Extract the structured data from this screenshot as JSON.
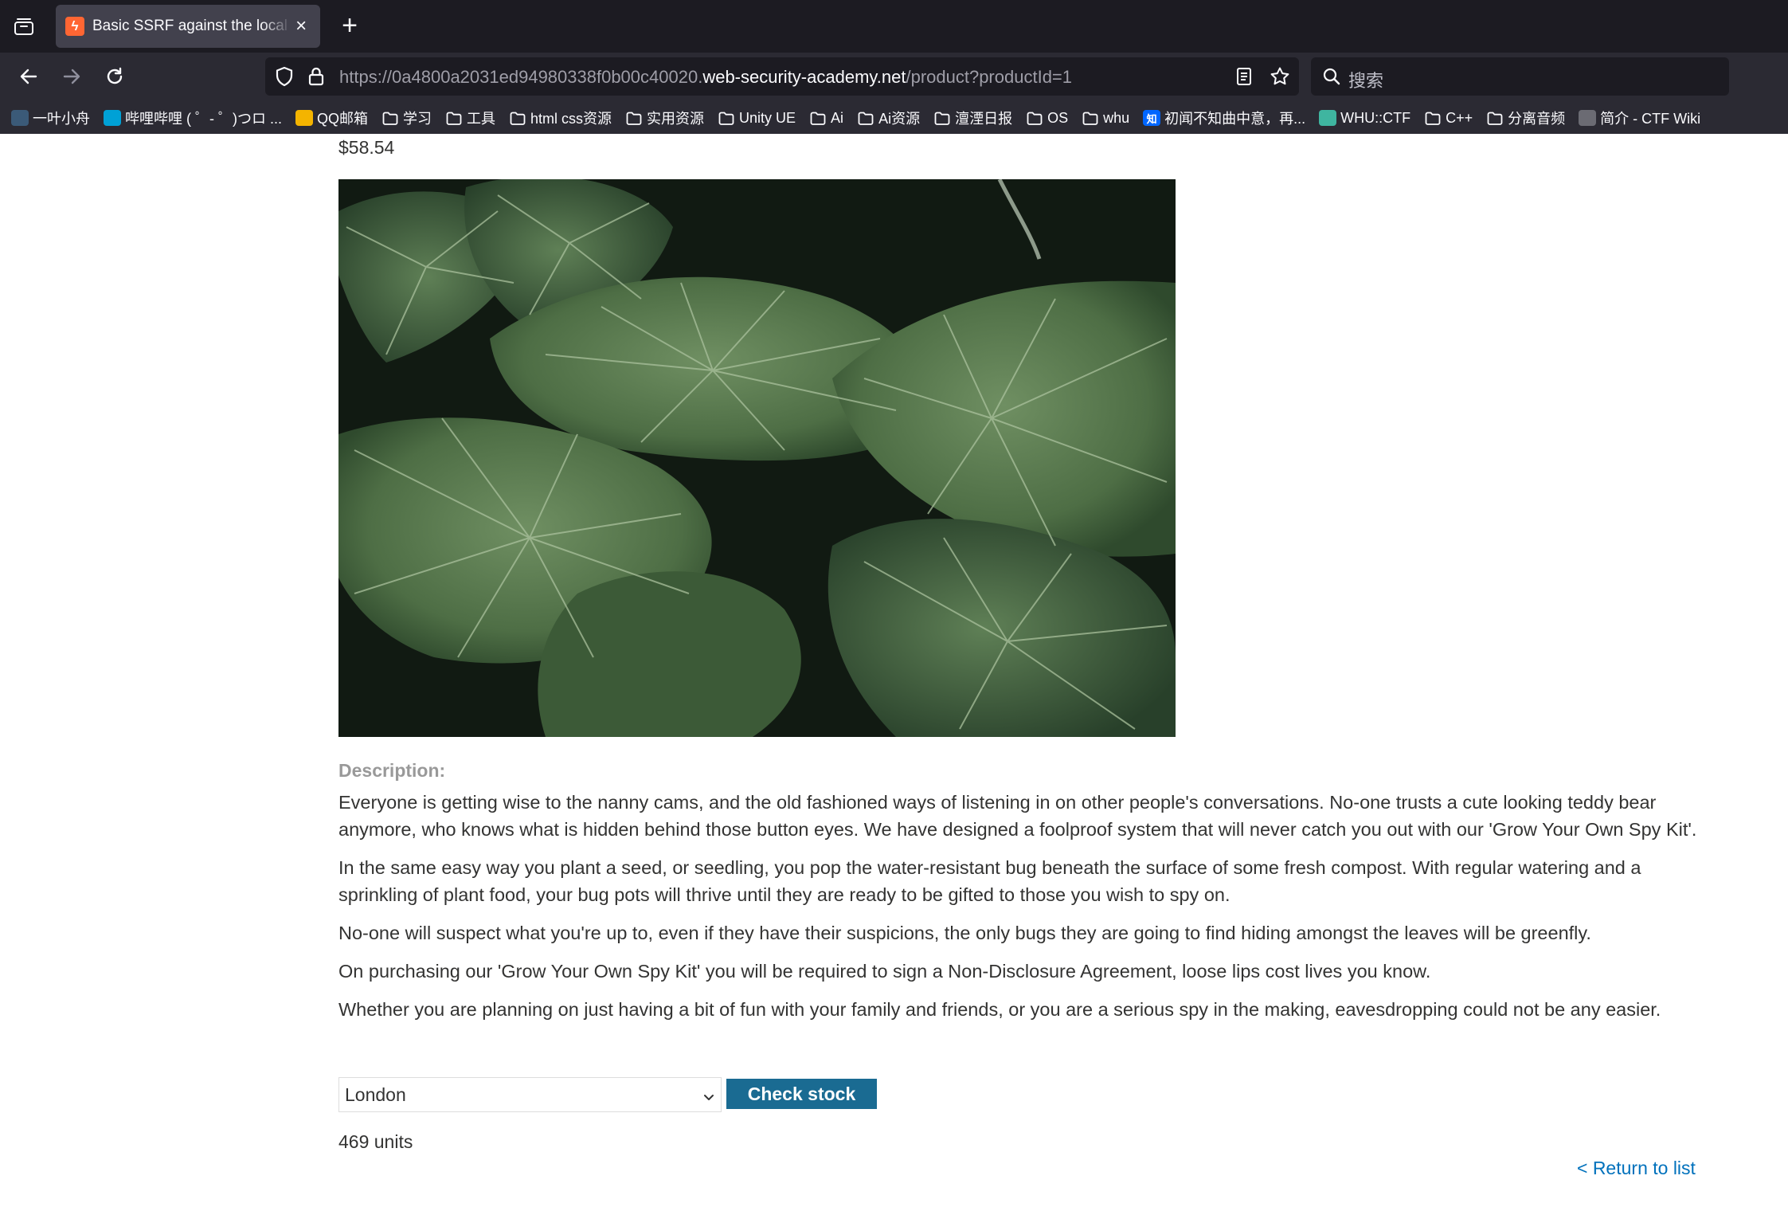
{
  "browser": {
    "tab": {
      "title": "Basic SSRF against the local s",
      "favicon": "lightning-bolt"
    },
    "url": {
      "prefix": "https://0a4800a2031ed94980338f0b00c40020.",
      "host": "web-security-academy.net",
      "path": "/product?productId=1"
    },
    "search": {
      "placeholder": "搜索"
    },
    "bookmarks": [
      {
        "label": "一叶小舟",
        "icon": "image-favicon"
      },
      {
        "label": "哔哩哔哩 ( ゜- ゜)つロ ...",
        "icon": "bilibili-favicon"
      },
      {
        "label": "QQ邮箱",
        "icon": "chrome-favicon"
      },
      {
        "label": "学习",
        "icon": "folder-icon"
      },
      {
        "label": "工具",
        "icon": "folder-icon"
      },
      {
        "label": "html css资源",
        "icon": "folder-icon"
      },
      {
        "label": "实用资源",
        "icon": "folder-icon"
      },
      {
        "label": "Unity UE",
        "icon": "folder-icon"
      },
      {
        "label": "Ai",
        "icon": "folder-icon"
      },
      {
        "label": "Ai资源",
        "icon": "folder-icon"
      },
      {
        "label": "澶湮日报",
        "icon": "folder-icon"
      },
      {
        "label": "OS",
        "icon": "folder-icon"
      },
      {
        "label": "whu",
        "icon": "folder-icon"
      },
      {
        "label": "初闻不知曲中意，再...",
        "icon": "zhihu-favicon"
      },
      {
        "label": "WHU::CTF",
        "icon": "ctf-favicon"
      },
      {
        "label": "C++",
        "icon": "folder-icon"
      },
      {
        "label": "分离音频",
        "icon": "folder-icon"
      },
      {
        "label": "简介 - CTF Wiki",
        "icon": "ctfwiki-favicon"
      }
    ]
  },
  "product": {
    "price": "$58.54",
    "description_label": "Description:",
    "paragraphs": [
      "Everyone is getting wise to the nanny cams, and the old fashioned ways of listening in on other people's conversations. No-one trusts a cute looking teddy bear anymore, who knows what is hidden behind those button eyes. We have designed a foolproof system that will never catch you out with our 'Grow Your Own Spy Kit'.",
      "In the same easy way you plant a seed, or seedling, you pop the water-resistant bug beneath the surface of some fresh compost. With regular watering and a sprinkling of plant food, your bug pots will thrive until they are ready to be gifted to those you wish to spy on.",
      "No-one will suspect what you're up to, even if they have their suspicions, the only bugs they are going to find hiding amongst the leaves will be greenfly.",
      "On purchasing our 'Grow Your Own Spy Kit' you will be required to sign a Non-Disclosure Agreement, loose lips cost lives you know.",
      "Whether you are planning on just having a bit of fun with your family and friends, or you are a serious spy in the making, eavesdropping could not be any easier."
    ]
  },
  "stock": {
    "selected_store": "London",
    "check_button": "Check stock",
    "result": "469 units"
  },
  "return_link": "< Return to list",
  "colors": {
    "button": "#1a6b92",
    "link": "#0071bc",
    "label": "#999999",
    "text": "#333332"
  }
}
